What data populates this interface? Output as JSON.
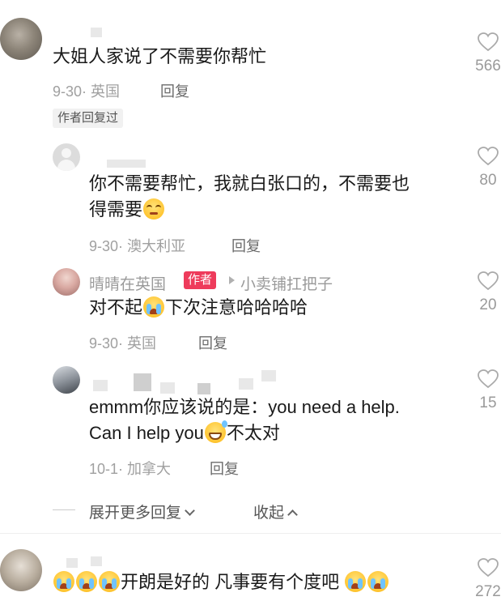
{
  "comments": [
    {
      "name": "",
      "text": "大姐人家说了不需要你帮忙",
      "date": "9-30",
      "location": "英国",
      "reply_label": "回复",
      "likes": "566",
      "author_replied_label": "作者回复过"
    }
  ],
  "replies": [
    {
      "name": "",
      "text_line1": "你不需要帮忙，我就白张口的，不需要也",
      "text_line2": "得需要",
      "emoji": "rolling-eyes-emoji",
      "date": "9-30",
      "location": "澳大利亚",
      "reply_label": "回复",
      "likes": "80"
    },
    {
      "name": "晴晴在英国",
      "author_tag": "作者",
      "reply_to": "小卖铺扛把子",
      "text_before": "对不起",
      "emoji": "crying-emoji",
      "text_after": "下次注意哈哈哈哈",
      "date": "9-30",
      "location": "英国",
      "reply_label": "回复",
      "likes": "20"
    },
    {
      "name": "",
      "text_line1": "emmm你应该说的是：you need a help.",
      "text_line2_before": "Can I help you",
      "emoji": "sweat-grin-emoji",
      "text_line2_after": "不太对",
      "date": "10-1",
      "location": "加拿大",
      "reply_label": "回复",
      "likes": "15"
    }
  ],
  "thread_controls": {
    "expand_more": "展开更多回复",
    "collapse": "收起"
  },
  "next_comment": {
    "text": "开朗是好的 凡事要有个度吧",
    "likes": "272"
  },
  "separator": "·",
  "colors": {
    "author_tag_bg": "#ee3b5b",
    "meta_text": "#a0a0a0",
    "main_text": "#1a1a1a"
  }
}
